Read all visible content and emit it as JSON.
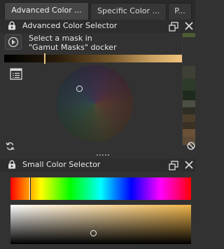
{
  "tabs": [
    {
      "label": "Advanced Color ...",
      "active": true
    },
    {
      "label": "Specific Color ...",
      "active": false
    },
    {
      "label": "P...",
      "active": false
    }
  ],
  "advanced_panel": {
    "title": "Advanced Color Selector",
    "mask_message_line1": "Select a mask in",
    "mask_message_line2": "\"Gamut Masks\" docker",
    "lightness_strip": {
      "from": "#000000",
      "to": "#f2c47e"
    },
    "wheel_hint": "hsv-wheel"
  },
  "history_swatches": [
    "#4b5d32",
    "#3e3f35",
    "#4c4f43",
    "#2c3b2a",
    "#1f2a1e",
    "#4b3f2c",
    "#2e2e26",
    "#5e4b37",
    "#4a3522",
    "#6b5137",
    "#3a3126"
  ],
  "small_panel": {
    "title": "Small Color Selector"
  },
  "colors": {
    "accent": "#f0b54a",
    "panel_bg": "#323232",
    "header_bg": "#2d2d2d"
  }
}
